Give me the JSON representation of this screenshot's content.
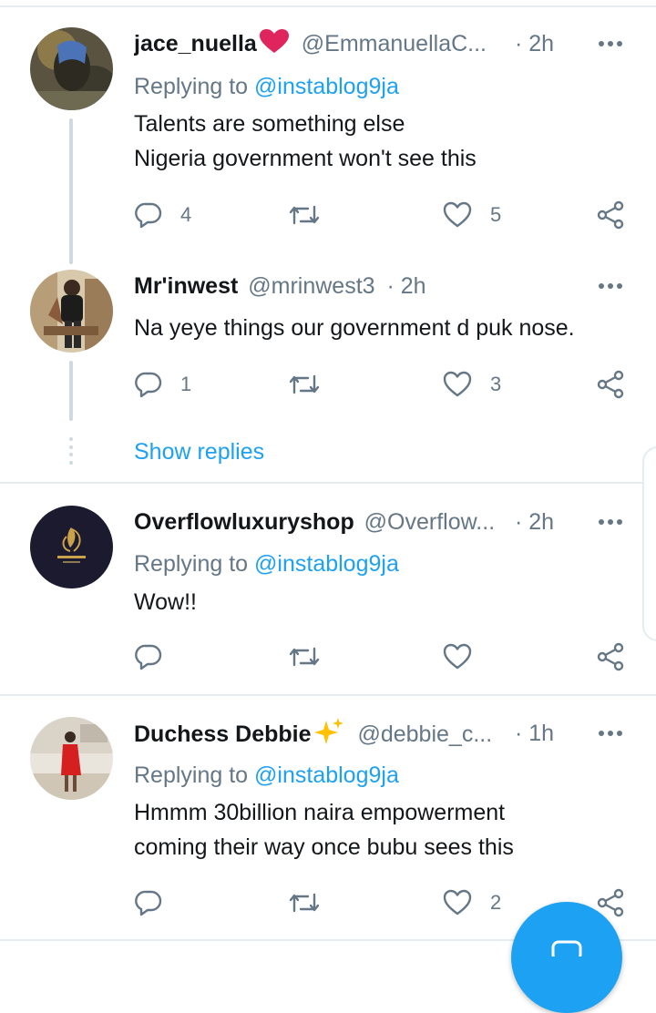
{
  "tweets": [
    {
      "name": "jace_nuella",
      "name_emoji": "heart",
      "handle": "@EmmanuellaC...",
      "time": "· 2h",
      "replying_prefix": "Replying to ",
      "replying_to": "@instablog9ja",
      "lines": [
        "Talents are something else",
        "Nigeria government won't see this"
      ],
      "replies": "4",
      "retweets": "",
      "likes": "5"
    },
    {
      "name": "Mr'inwest",
      "handle": "@mrinwest3",
      "time": "· 2h",
      "lines": [
        "Na yeye things our government d puk nose."
      ],
      "replies": "1",
      "retweets": "",
      "likes": "3"
    },
    {
      "name": "Overflowluxuryshop",
      "handle": "@Overflow...",
      "time": "· 2h",
      "replying_prefix": "Replying to ",
      "replying_to": "@instablog9ja",
      "lines": [
        "Wow!!"
      ],
      "replies": "",
      "retweets": "",
      "likes": ""
    },
    {
      "name": "Duchess Debbie",
      "name_emoji": "sparkles",
      "handle": "@debbie_c...",
      "time": "· 1h",
      "replying_prefix": "Replying to ",
      "replying_to": "@instablog9ja",
      "lines": [
        "Hmmm 30billion naira empowerment",
        "coming their way once bubu sees this"
      ],
      "replies": "",
      "retweets": "",
      "likes": "2"
    }
  ],
  "show_replies": "Show replies",
  "colors": {
    "link": "#1da1f2",
    "muted": "#657786",
    "text": "#14171a",
    "divider": "#e6ecf0",
    "heart_emoji": "#e0245e",
    "sparkle_emoji": "#ffc107"
  },
  "icons": [
    "reply-icon",
    "retweet-icon",
    "like-icon",
    "share-icon",
    "more-icon",
    "compose-icon"
  ]
}
